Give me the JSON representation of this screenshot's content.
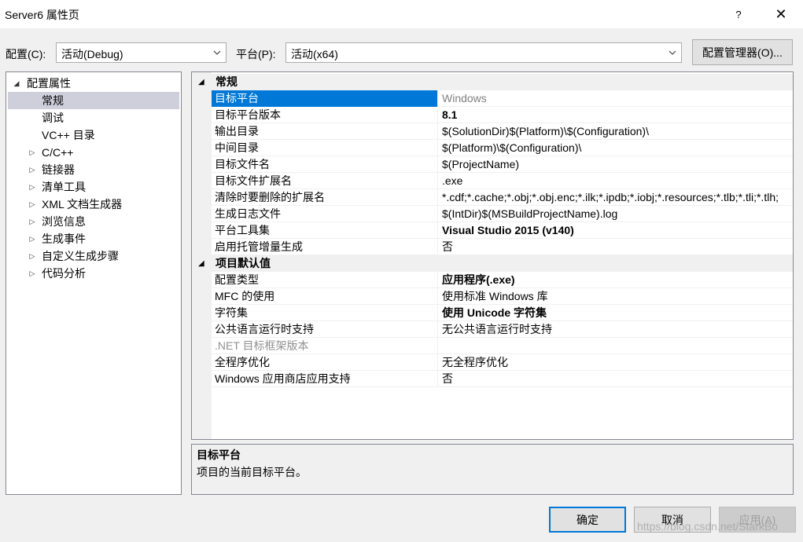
{
  "window": {
    "title": "Server6 属性页",
    "help_label": "?",
    "close_label": "✕"
  },
  "toolbar": {
    "config_label": "配置(C):",
    "config_value": "活动(Debug)",
    "platform_label": "平台(P):",
    "platform_value": "活动(x64)",
    "config_manager_label": "配置管理器(O)..."
  },
  "tree": {
    "items": [
      {
        "label": "配置属性",
        "toggle": "◢"
      },
      {
        "label": "常规"
      },
      {
        "label": "调试"
      },
      {
        "label": "VC++ 目录"
      },
      {
        "label": "C/C++",
        "toggle": "▷"
      },
      {
        "label": "链接器",
        "toggle": "▷"
      },
      {
        "label": "清单工具",
        "toggle": "▷"
      },
      {
        "label": "XML 文档生成器",
        "toggle": "▷"
      },
      {
        "label": "浏览信息",
        "toggle": "▷"
      },
      {
        "label": "生成事件",
        "toggle": "▷"
      },
      {
        "label": "自定义生成步骤",
        "toggle": "▷"
      },
      {
        "label": "代码分析",
        "toggle": "▷"
      }
    ]
  },
  "grid": {
    "categories": [
      {
        "label": "常规",
        "rows": [
          {
            "name": "目标平台",
            "value": "Windows"
          },
          {
            "name": "目标平台版本",
            "value": "8.1"
          },
          {
            "name": "输出目录",
            "value": "$(SolutionDir)$(Platform)\\$(Configuration)\\"
          },
          {
            "name": "中间目录",
            "value": "$(Platform)\\$(Configuration)\\"
          },
          {
            "name": "目标文件名",
            "value": "$(ProjectName)"
          },
          {
            "name": "目标文件扩展名",
            "value": ".exe"
          },
          {
            "name": "清除时要删除的扩展名",
            "value": "*.cdf;*.cache;*.obj;*.obj.enc;*.ilk;*.ipdb;*.iobj;*.resources;*.tlb;*.tli;*.tlh;"
          },
          {
            "name": "生成日志文件",
            "value": "$(IntDir)$(MSBuildProjectName).log"
          },
          {
            "name": "平台工具集",
            "value": "Visual Studio 2015 (v140)"
          },
          {
            "name": "启用托管增量生成",
            "value": "否"
          }
        ]
      },
      {
        "label": "项目默认值",
        "rows": [
          {
            "name": "配置类型",
            "value": "应用程序(.exe)"
          },
          {
            "name": "MFC 的使用",
            "value": "使用标准 Windows 库"
          },
          {
            "name": "字符集",
            "value": "使用 Unicode 字符集"
          },
          {
            "name": "公共语言运行时支持",
            "value": "无公共语言运行时支持"
          },
          {
            "name": ".NET 目标框架版本",
            "value": ""
          },
          {
            "name": "全程序优化",
            "value": "无全程序优化"
          },
          {
            "name": "Windows 应用商店应用支持",
            "value": "否"
          }
        ]
      }
    ]
  },
  "description": {
    "title": "目标平台",
    "text": "项目的当前目标平台。"
  },
  "buttons": {
    "ok": "确定",
    "cancel": "取消",
    "apply": "应用(A)"
  },
  "watermark": "https://blog.csdn.net/StarkBo"
}
